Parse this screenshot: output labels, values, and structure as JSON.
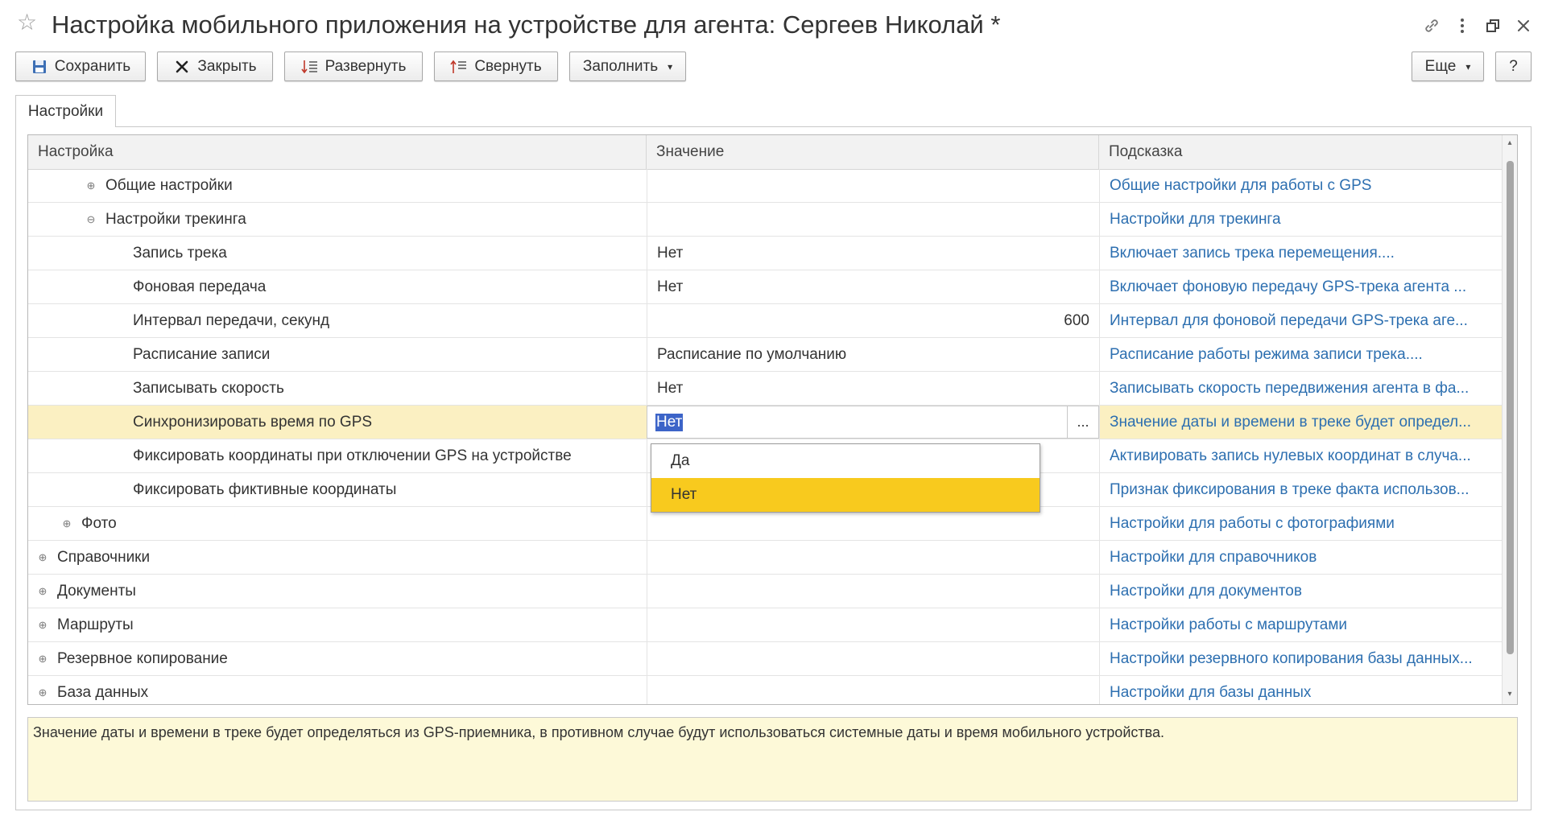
{
  "window": {
    "title": "Настройка мобильного приложения на устройстве для агента: Сергеев Николай *"
  },
  "toolbar": {
    "save_label": "Сохранить",
    "close_label": "Закрыть",
    "expand_label": "Развернуть",
    "collapse_label": "Свернуть",
    "fill_label": "Заполнить",
    "more_label": "Еще",
    "help_label": "?"
  },
  "tabs": [
    {
      "label": "Настройки",
      "active": true
    }
  ],
  "grid": {
    "columns": [
      "Настройка",
      "Значение",
      "Подсказка"
    ],
    "rows": [
      {
        "name": "Общие настройки",
        "value": "",
        "hint": "Общие настройки для работы с GPS",
        "level": 2,
        "toggle": "⊕"
      },
      {
        "name": "Настройки трекинга",
        "value": "",
        "hint": "Настройки для трекинга",
        "level": 2,
        "toggle": "⊖"
      },
      {
        "name": "Запись трека",
        "value": "Нет",
        "hint": "Включает запись трека перемещения....",
        "level": 3
      },
      {
        "name": "Фоновая передача",
        "value": "Нет",
        "hint": "Включает фоновую передачу GPS-трека агента ...",
        "level": 3
      },
      {
        "name": "Интервал передачи, секунд",
        "value": "600",
        "hint": "Интервал для фоновой передачи GPS-трека аге...",
        "level": 3,
        "numeric": true
      },
      {
        "name": "Расписание записи",
        "value": "Расписание по умолчанию",
        "hint": "Расписание работы режима записи трека....",
        "level": 3
      },
      {
        "name": "Записывать скорость",
        "value": "Нет",
        "hint": "Записывать скорость передвижения агента в фа...",
        "level": 3
      },
      {
        "name": "Синхронизировать время по GPS",
        "value": "Нет",
        "hint": "Значение даты и времени в треке будет определ...",
        "level": 3,
        "selected": true
      },
      {
        "name": "Фиксировать координаты при отключении GPS на устройстве",
        "value": "",
        "hint": "Активировать запись нулевых координат в случа...",
        "level": 3
      },
      {
        "name": "Фиксировать фиктивные координаты",
        "value": "",
        "hint": "Признак фиксирования в треке факта использов...",
        "level": 3
      },
      {
        "name": "Фото",
        "value": "",
        "hint": "Настройки для работы с фотографиями",
        "level": 1,
        "toggle": "⊕"
      },
      {
        "name": "Справочники",
        "value": "",
        "hint": "Настройки для справочников",
        "level": 0,
        "toggle": "⊕"
      },
      {
        "name": "Документы",
        "value": "",
        "hint": "Настройки для документов",
        "level": 0,
        "toggle": "⊕"
      },
      {
        "name": "Маршруты",
        "value": "",
        "hint": "Настройки работы с маршрутами",
        "level": 0,
        "toggle": "⊕"
      },
      {
        "name": "Резервное копирование",
        "value": "",
        "hint": "Настройки резервного копирования базы данных...",
        "level": 0,
        "toggle": "⊕"
      },
      {
        "name": "База данных",
        "value": "",
        "hint": "Настройки для базы данных",
        "level": 0,
        "toggle": "⊕"
      }
    ]
  },
  "editor": {
    "value": "Нет",
    "button_label": "..."
  },
  "dropdown": {
    "options": [
      "Да",
      "Нет"
    ],
    "selected": "Нет"
  },
  "hint_panel": {
    "text": "Значение даты и времени в треке будет определяться из GPS-приемника, в противном случае будут использоваться системные даты и время мобильного устройства."
  },
  "colors": {
    "hint_link": "#2d6fb0",
    "selected_row": "#fbf0c2",
    "dropdown_active": "#f8ca1e",
    "hint_panel_bg": "#fdf9d8",
    "text_selection": "#3c64c8"
  }
}
